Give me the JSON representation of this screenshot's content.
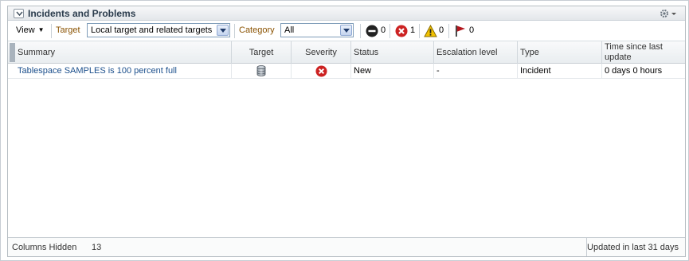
{
  "panel": {
    "title": "Incidents and Problems"
  },
  "toolbar": {
    "view_label": "View",
    "target_label": "Target",
    "target_value": "Local target and related targets",
    "category_label": "Category",
    "category_value": "All",
    "counts": {
      "fatal": "0",
      "critical": "1",
      "warning": "0",
      "escalated": "0"
    }
  },
  "table": {
    "columns": [
      "Summary",
      "Target",
      "Severity",
      "Status",
      "Escalation level",
      "Type",
      "Time since last update"
    ],
    "rows": [
      {
        "summary": "Tablespace SAMPLES is 100 percent full",
        "target_icon": "database-icon",
        "severity_icon": "critical-icon",
        "status": "New",
        "escalation_level": "-",
        "type": "Incident",
        "time_since_update": "0 days 0 hours"
      }
    ]
  },
  "footer": {
    "columns_hidden_label": "Columns Hidden",
    "columns_hidden_count": "13",
    "updated_text": "Updated in last 31 days"
  },
  "colors": {
    "link": "#1b4f8c",
    "filter_label": "#8a5200",
    "critical": "#cc2222",
    "warning": "#f2c200",
    "flag": "#b3171e"
  }
}
